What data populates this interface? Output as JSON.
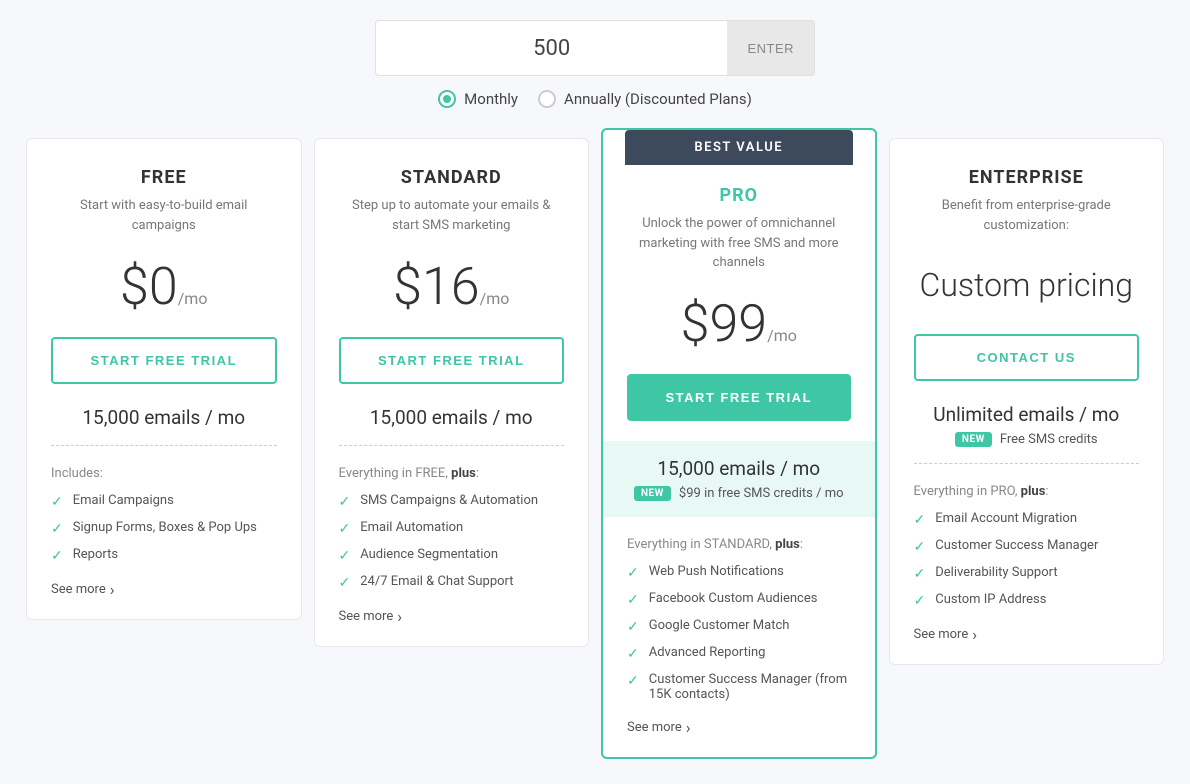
{
  "top": {
    "contact_count": "500",
    "enter_label": "ENTER",
    "billing_options": [
      {
        "id": "monthly",
        "label": "Monthly",
        "selected": true
      },
      {
        "id": "annually",
        "label": "Annually (Discounted Plans)",
        "selected": false
      }
    ]
  },
  "plans": {
    "free": {
      "name": "FREE",
      "description": "Start with easy-to-build email campaigns",
      "price": "$0",
      "period": "/mo",
      "cta": "START FREE TRIAL",
      "emails": "15,000 emails / mo",
      "features_label": "Includes:",
      "features": [
        "Email Campaigns",
        "Signup Forms, Boxes & Pop Ups",
        "Reports"
      ],
      "see_more": "See more"
    },
    "standard": {
      "name": "STANDARD",
      "description": "Step up to automate your emails & start SMS marketing",
      "price": "$16",
      "period": "/mo",
      "cta": "START FREE TRIAL",
      "emails": "15,000 emails / mo",
      "features_label_prefix": "Everything in FREE,",
      "features_label_bold": "plus",
      "features": [
        "SMS Campaigns & Automation",
        "Email Automation",
        "Audience Segmentation",
        "24/7 Email & Chat Support"
      ],
      "see_more": "See more"
    },
    "pro": {
      "banner": "BEST VALUE",
      "name": "PRO",
      "description": "Unlock the power of omnichannel marketing with free SMS and more channels",
      "price": "$99",
      "period": "/mo",
      "cta": "START FREE TRIAL",
      "emails": "15,000 emails / mo",
      "sms_new": "NEW",
      "sms_text": "$99 in free SMS credits / mo",
      "features_label_prefix": "Everything in STANDARD,",
      "features_label_bold": "plus",
      "features": [
        "Web Push Notifications",
        "Facebook Custom Audiences",
        "Google Customer Match",
        "Advanced Reporting",
        "Customer Success Manager (from 15K contacts)"
      ],
      "see_more": "See more"
    },
    "enterprise": {
      "name": "ENTERPRISE",
      "description": "Benefit from enterprise-grade customization:",
      "price_custom": "Custom pricing",
      "cta": "CONTACT US",
      "emails": "Unlimited emails / mo",
      "sms_new": "NEW",
      "sms_text": "Free SMS credits",
      "features_label_prefix": "Everything in PRO,",
      "features_label_bold": "plus",
      "features": [
        "Email Account Migration",
        "Customer Success Manager",
        "Deliverability Support",
        "Custom IP Address"
      ],
      "see_more": "See more"
    }
  }
}
